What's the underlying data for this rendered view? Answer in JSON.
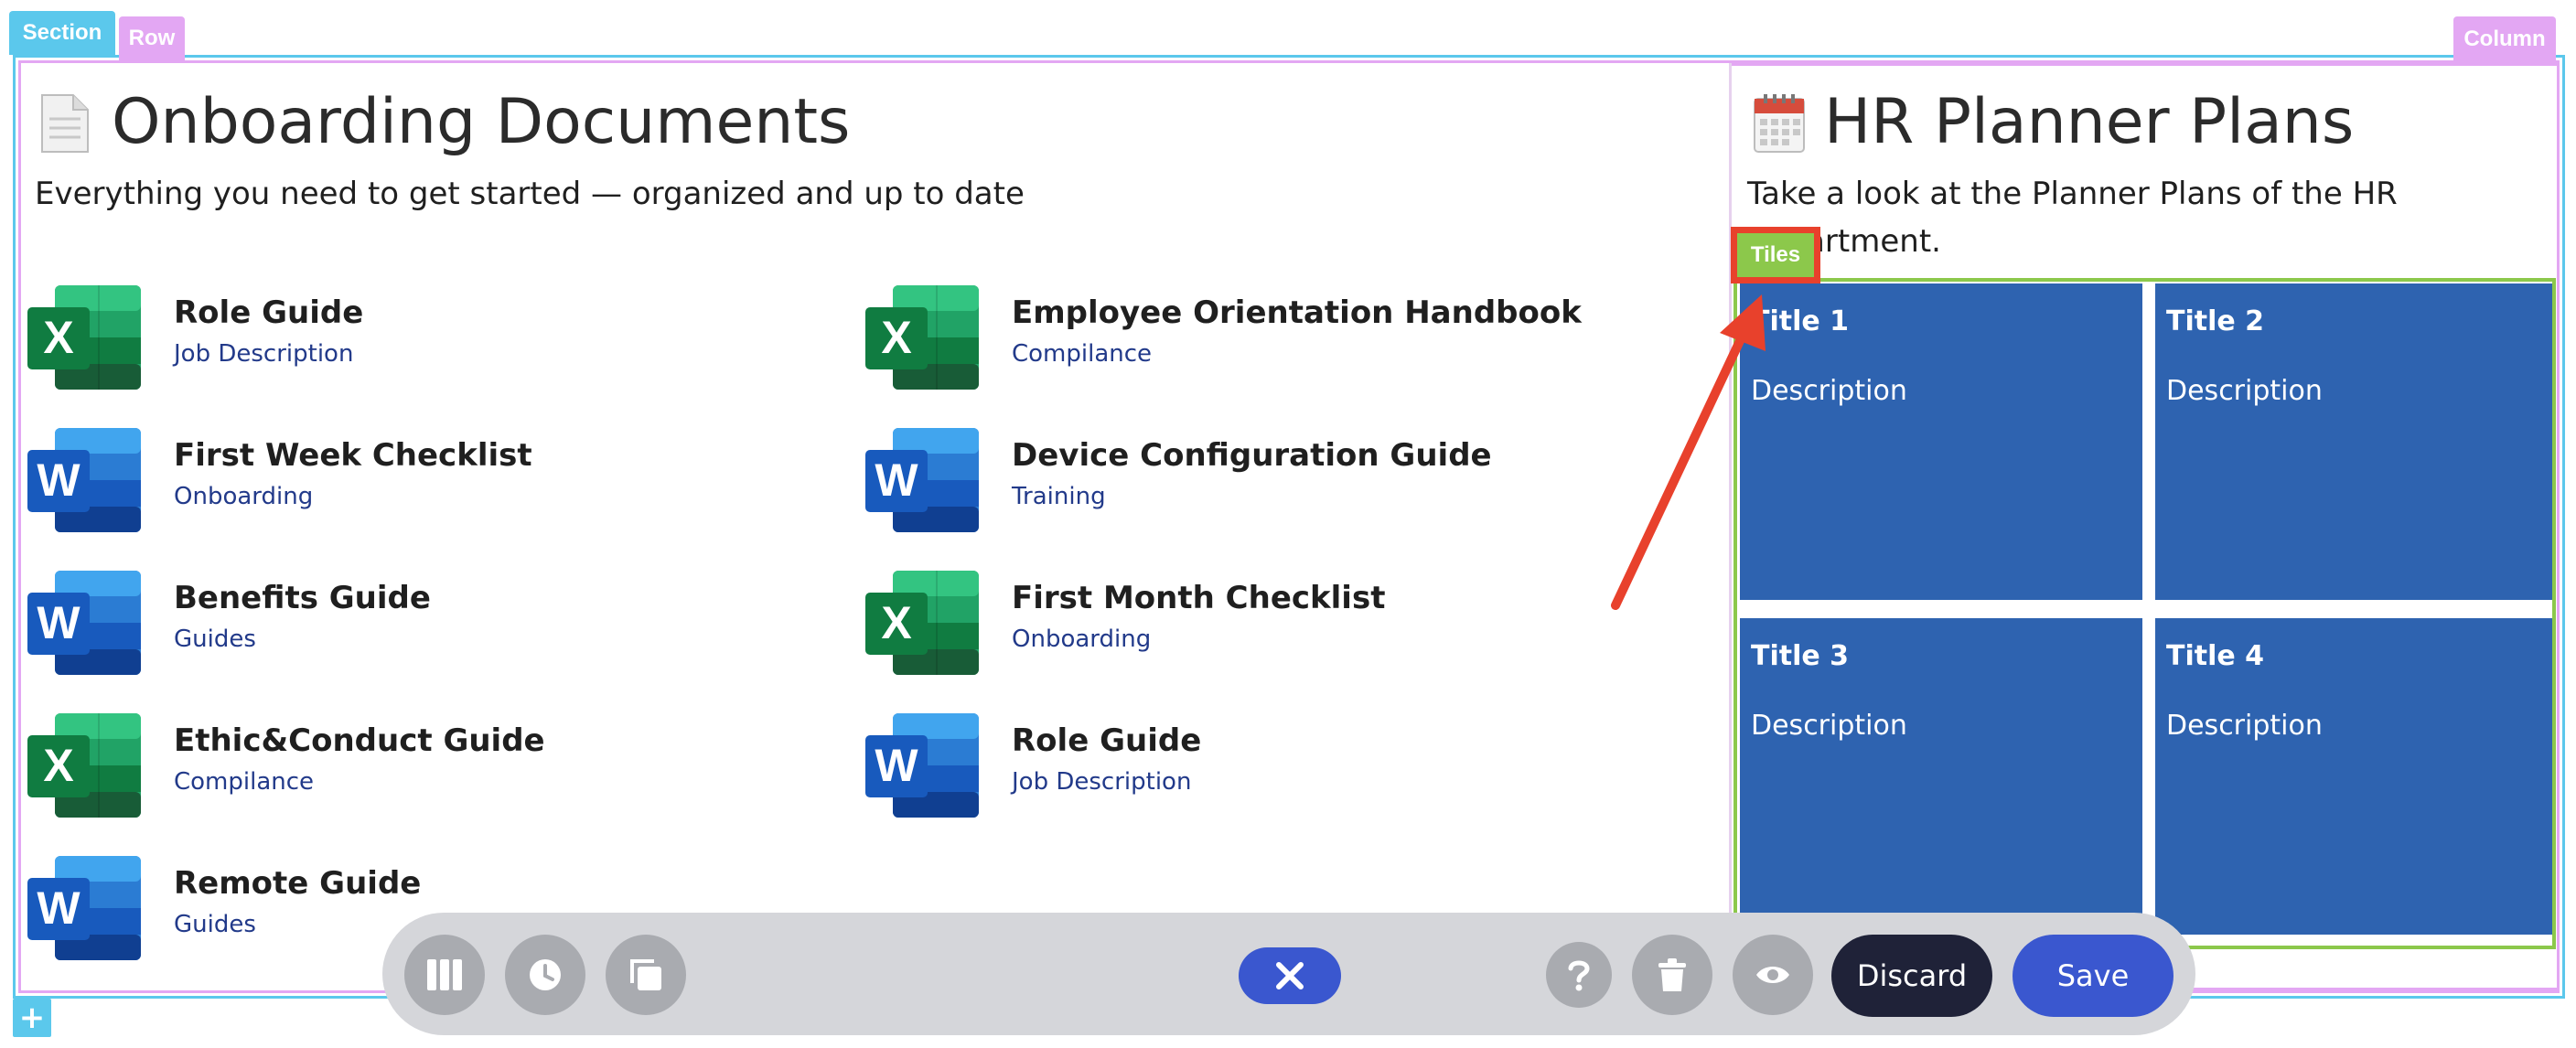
{
  "editor": {
    "section_tag": "Section",
    "row_tag": "Row",
    "column_tag": "Column",
    "tiles_tag": "Tiles",
    "add_symbol": "+"
  },
  "left": {
    "title": "Onboarding Documents",
    "subtitle": "Everything you need to get started — organized and up to date",
    "documents": [
      {
        "title": "Role Guide",
        "category": "Job Description",
        "app": "excel"
      },
      {
        "title": "Employee Orientation Handbook",
        "category": "Compilance",
        "app": "excel"
      },
      {
        "title": "First Week Checklist",
        "category": "Onboarding",
        "app": "word"
      },
      {
        "title": "Device Configuration Guide",
        "category": "Training",
        "app": "word"
      },
      {
        "title": "Benefits Guide",
        "category": "Guides",
        "app": "word"
      },
      {
        "title": "First Month Checklist",
        "category": "Onboarding",
        "app": "excel"
      },
      {
        "title": "Ethic&Conduct Guide",
        "category": "Compilance",
        "app": "excel"
      },
      {
        "title": "Role Guide",
        "category": "Job Description",
        "app": "word"
      },
      {
        "title": "Remote Guide",
        "category": "Guides",
        "app": "word"
      }
    ]
  },
  "right": {
    "title": "HR Planner Plans",
    "subtitle_line1": "Take a look at the Planner Plans of the HR",
    "subtitle_line2": "department.",
    "tiles": [
      {
        "title": "Title 1",
        "description": "Description"
      },
      {
        "title": "Title 2",
        "description": "Description"
      },
      {
        "title": "Title 3",
        "description": "Description"
      },
      {
        "title": "Title 4",
        "description": "Description"
      }
    ]
  },
  "toolbar": {
    "discard_label": "Discard",
    "save_label": "Save",
    "icons": [
      "columns-icon",
      "history-icon",
      "copy-icon",
      "close-icon",
      "help-icon",
      "trash-icon",
      "eye-icon"
    ]
  },
  "colors": {
    "section": "#5bc8ec",
    "row": "#e3a7f3",
    "tiles": "#8cc84b",
    "tile_bg": "#2e63b0",
    "annotation": "#e8412c",
    "primary_button": "#3a57cf",
    "discard_button": "#1f2238"
  }
}
